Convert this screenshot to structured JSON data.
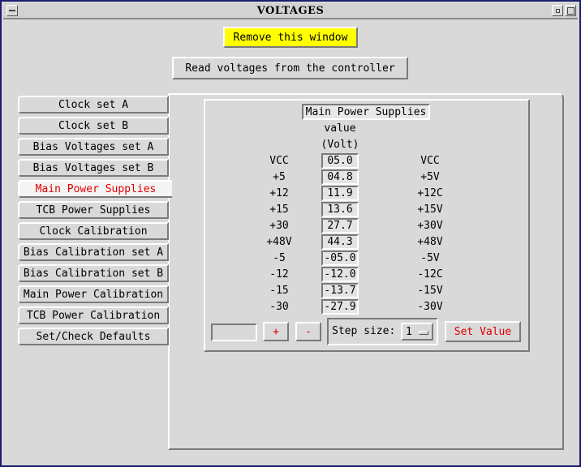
{
  "window": {
    "title": "VOLTAGES"
  },
  "buttons": {
    "remove": "Remove this window",
    "read": "Read voltages from the controller"
  },
  "tabs": [
    {
      "label": "Clock set A",
      "active": false
    },
    {
      "label": "Clock set B",
      "active": false
    },
    {
      "label": "Bias Voltages set A",
      "active": false
    },
    {
      "label": "Bias Voltages set B",
      "active": false
    },
    {
      "label": "Main Power Supplies",
      "active": true
    },
    {
      "label": "TCB Power Supplies",
      "active": false
    },
    {
      "label": "Clock Calibration",
      "active": false
    },
    {
      "label": "Bias Calibration set A",
      "active": false
    },
    {
      "label": "Bias Calibration set B",
      "active": false
    },
    {
      "label": "Main Power Calibration",
      "active": false
    },
    {
      "label": "TCB Power Calibration",
      "active": false
    },
    {
      "label": "Set/Check Defaults",
      "active": false
    }
  ],
  "panel": {
    "title": "Main Power Supplies",
    "value_header": "value",
    "unit_header": "(Volt)",
    "rows": [
      {
        "label": "VCC",
        "value": "05.0",
        "name": "VCC"
      },
      {
        "label": "+5",
        "value": "04.8",
        "name": "+5V"
      },
      {
        "label": "+12",
        "value": "11.9",
        "name": "+12C"
      },
      {
        "label": "+15",
        "value": "13.6",
        "name": "+15V"
      },
      {
        "label": "+30",
        "value": "27.7",
        "name": "+30V"
      },
      {
        "label": "+48V",
        "value": "44.3",
        "name": "+48V"
      },
      {
        "label": "-5",
        "value": "-05.0",
        "name": "-5V"
      },
      {
        "label": "-12",
        "value": "-12.0",
        "name": "-12C"
      },
      {
        "label": "-15",
        "value": "-13.7",
        "name": "-15V"
      },
      {
        "label": "-30",
        "value": "-27.9",
        "name": "-30V"
      }
    ],
    "controls": {
      "entry_value": "",
      "plus": "+",
      "minus": "-",
      "step_label": "Step size:",
      "step_value": "1",
      "set_value": "Set Value"
    }
  },
  "colors": {
    "accent_red": "#e00000",
    "highlight_yellow": "#ffff00",
    "frame": "#1c1c6e"
  }
}
